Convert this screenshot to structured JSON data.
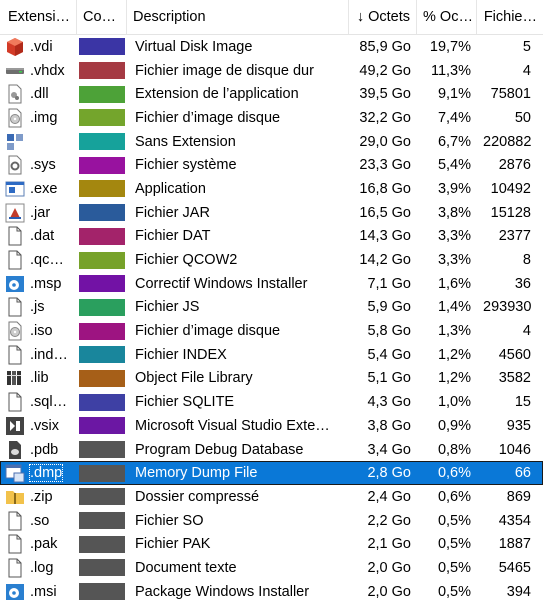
{
  "header": {
    "ext": "Extensi…",
    "color": "Co…",
    "desc": "Description",
    "octets": "↓ Octets",
    "pct": "% Oc…",
    "files": "Fichie…"
  },
  "rows": [
    {
      "icon": "virtualbox-icon",
      "ext": ".vdi",
      "color": "#3b35a5",
      "desc": "Virtual Disk Image",
      "octets": "85,9 Go",
      "pct": "19,7%",
      "files": "5"
    },
    {
      "icon": "drive-icon",
      "ext": ".vhdx",
      "color": "#a53a43",
      "desc": "Fichier image de disque dur",
      "octets": "49,2 Go",
      "pct": "11,3%",
      "files": "4"
    },
    {
      "icon": "dll-file-icon",
      "ext": ".dll",
      "color": "#4da238",
      "desc": "Extension de l’application",
      "octets": "39,5 Go",
      "pct": "9,1%",
      "files": "75801"
    },
    {
      "icon": "disc-image-icon",
      "ext": ".img",
      "color": "#74a52c",
      "desc": "Fichier d’image disque",
      "octets": "32,2 Go",
      "pct": "7,4%",
      "files": "50"
    },
    {
      "icon": "generic-app-icon",
      "ext": "",
      "color": "#16a29b",
      "desc": "Sans Extension",
      "octets": "29,0 Go",
      "pct": "6,7%",
      "files": "220882"
    },
    {
      "icon": "system-file-icon",
      "ext": ".sys",
      "color": "#98129f",
      "desc": "Fichier système",
      "octets": "23,3 Go",
      "pct": "5,4%",
      "files": "2876"
    },
    {
      "icon": "exe-icon",
      "ext": ".exe",
      "color": "#a4870f",
      "desc": "Application",
      "octets": "16,8 Go",
      "pct": "3,9%",
      "files": "10492"
    },
    {
      "icon": "java-icon",
      "ext": ".jar",
      "color": "#2a5b9b",
      "desc": "Fichier JAR",
      "octets": "16,5 Go",
      "pct": "3,8%",
      "files": "15128"
    },
    {
      "icon": "blank-file-icon",
      "ext": ".dat",
      "color": "#a3236a",
      "desc": "Fichier DAT",
      "octets": "14,3 Go",
      "pct": "3,3%",
      "files": "2377"
    },
    {
      "icon": "blank-file-icon",
      "ext": ".qc…",
      "color": "#77a22a",
      "desc": "Fichier QCOW2",
      "octets": "14,2 Go",
      "pct": "3,3%",
      "files": "8"
    },
    {
      "icon": "installer-icon",
      "ext": ".msp",
      "color": "#7212a5",
      "desc": "Correctif Windows Installer",
      "octets": "7,1 Go",
      "pct": "1,6%",
      "files": "36"
    },
    {
      "icon": "blank-file-icon",
      "ext": ".js",
      "color": "#2a9f5e",
      "desc": "Fichier JS",
      "octets": "5,9 Go",
      "pct": "1,4%",
      "files": "293930"
    },
    {
      "icon": "disc-image-icon",
      "ext": ".iso",
      "color": "#9d1481",
      "desc": "Fichier d’image disque",
      "octets": "5,8 Go",
      "pct": "1,3%",
      "files": "4"
    },
    {
      "icon": "blank-file-icon",
      "ext": ".ind…",
      "color": "#19869c",
      "desc": "Fichier INDEX",
      "octets": "5,4 Go",
      "pct": "1,2%",
      "files": "4560"
    },
    {
      "icon": "library-icon",
      "ext": ".lib",
      "color": "#a65f18",
      "desc": "Object File Library",
      "octets": "5,1 Go",
      "pct": "1,2%",
      "files": "3582"
    },
    {
      "icon": "blank-file-icon",
      "ext": ".sql…",
      "color": "#3e40a4",
      "desc": "Fichier SQLITE",
      "octets": "4,3 Go",
      "pct": "1,0%",
      "files": "15"
    },
    {
      "icon": "vsix-icon",
      "ext": ".vsix",
      "color": "#6b17a3",
      "desc": "Microsoft Visual Studio Exte…",
      "octets": "3,8 Go",
      "pct": "0,9%",
      "files": "935"
    },
    {
      "icon": "pdb-icon",
      "ext": ".pdb",
      "color": "#555555",
      "desc": "Program Debug Database",
      "octets": "3,4 Go",
      "pct": "0,8%",
      "files": "1046"
    },
    {
      "icon": "dump-icon",
      "ext": ".dmp",
      "color": "#555555",
      "desc": "Memory Dump File",
      "octets": "2,8 Go",
      "pct": "0,6%",
      "files": "66",
      "selected": true
    },
    {
      "icon": "zip-folder-icon",
      "ext": ".zip",
      "color": "#555555",
      "desc": "Dossier compressé",
      "octets": "2,4 Go",
      "pct": "0,6%",
      "files": "869"
    },
    {
      "icon": "blank-file-icon",
      "ext": ".so",
      "color": "#555555",
      "desc": "Fichier SO",
      "octets": "2,2 Go",
      "pct": "0,5%",
      "files": "4354"
    },
    {
      "icon": "blank-file-icon",
      "ext": ".pak",
      "color": "#555555",
      "desc": "Fichier PAK",
      "octets": "2,1 Go",
      "pct": "0,5%",
      "files": "1887"
    },
    {
      "icon": "blank-file-icon",
      "ext": ".log",
      "color": "#555555",
      "desc": "Document texte",
      "octets": "2,0 Go",
      "pct": "0,5%",
      "files": "5465"
    },
    {
      "icon": "installer-icon",
      "ext": ".msi",
      "color": "#555555",
      "desc": "Package Windows Installer",
      "octets": "2,0 Go",
      "pct": "0,5%",
      "files": "394"
    }
  ]
}
